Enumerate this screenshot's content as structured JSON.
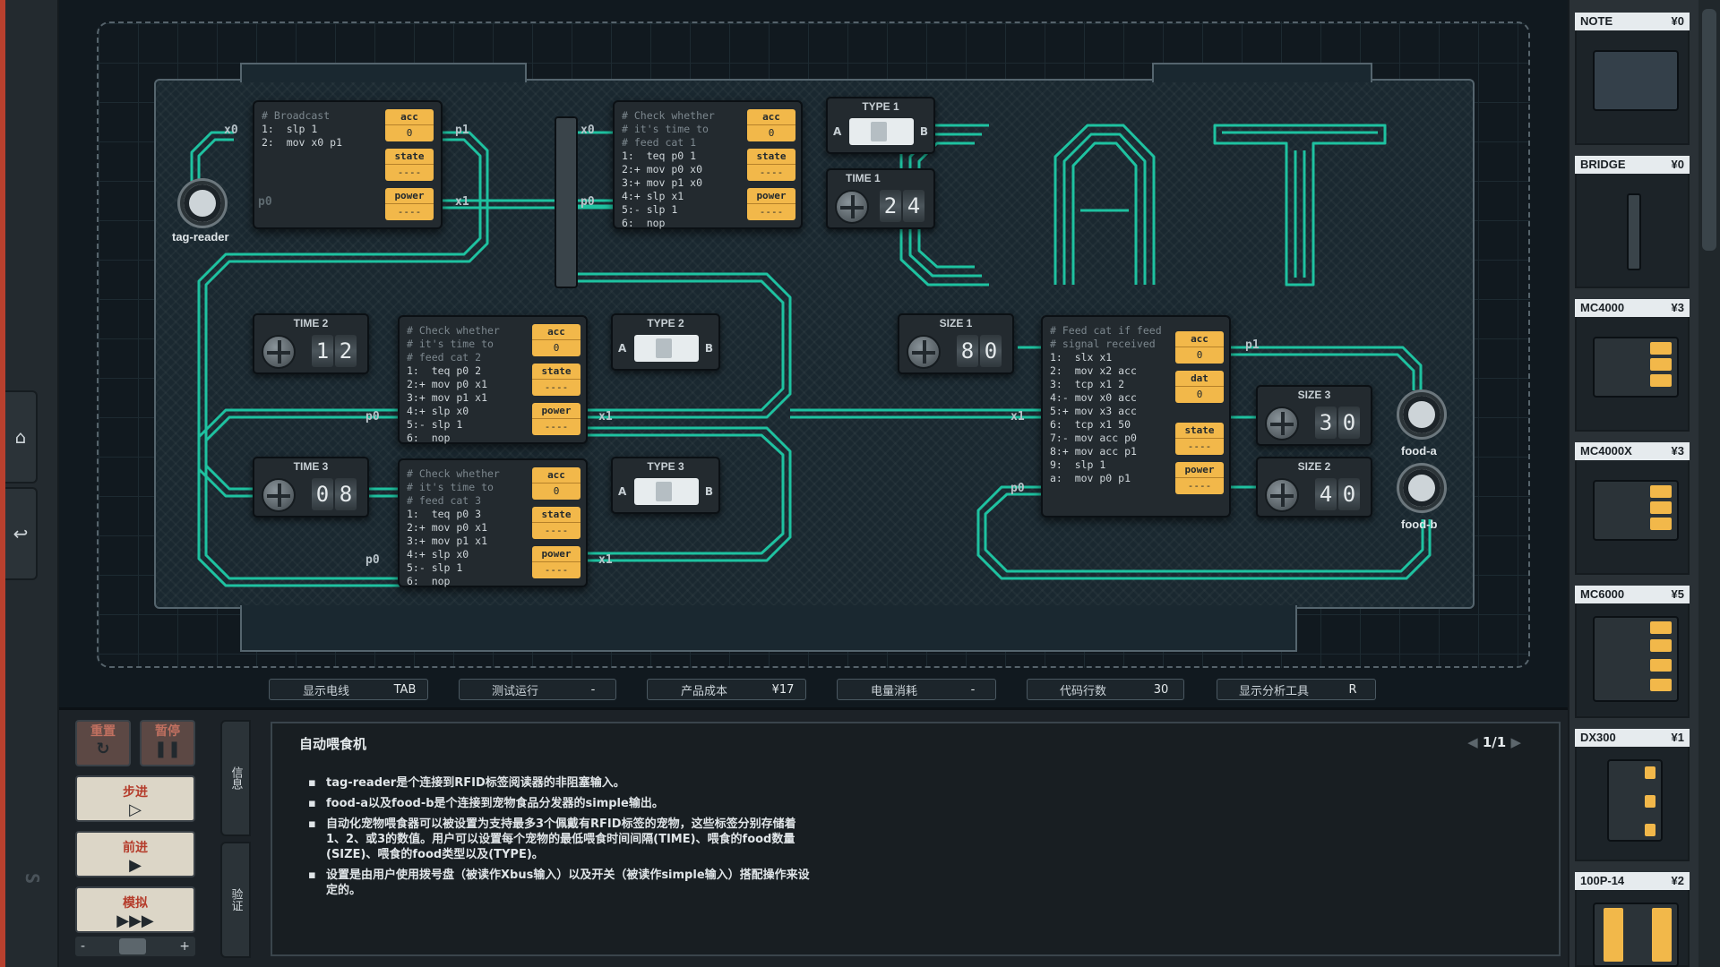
{
  "colors": {
    "wire": "#1fd3ad",
    "register": "#f2b84a",
    "accent_red": "#b8402e"
  },
  "sidebar": {
    "home_icon": "home-icon",
    "back_icon": "undo-icon"
  },
  "board": {
    "title_art": "CAT",
    "tag_reader": {
      "label": "tag-reader"
    },
    "food_a": {
      "label": "food-a"
    },
    "food_b": {
      "label": "food-b"
    },
    "mc_broadcast": {
      "comment": "# Broadcast",
      "lines": [
        "1:  slp 1",
        "2:  mov x0 p1"
      ],
      "ports": {
        "left_top": "x0",
        "right_top": "p1",
        "left_bottom": "p0",
        "right_bottom": "x1"
      },
      "registers": [
        {
          "label": "acc",
          "value": "0"
        },
        {
          "label": "state",
          "value": "----"
        },
        {
          "label": "power",
          "value": "----"
        }
      ]
    },
    "mc_cat1": {
      "comment": [
        "# Check whether",
        "# it's time to",
        "# feed cat 1"
      ],
      "lines": [
        "1:  teq p0 1",
        "2:+ mov p0 x0",
        "3:+ mov p1 x0",
        "4:+ slp x1",
        "5:- slp 1",
        "6:  nop"
      ],
      "ports": {
        "left_top": "x0",
        "left_bottom": "p0"
      },
      "registers": [
        {
          "label": "acc",
          "value": "0"
        },
        {
          "label": "state",
          "value": "----"
        },
        {
          "label": "power",
          "value": "----"
        }
      ]
    },
    "mc_cat2": {
      "comment": [
        "# Check whether",
        "# it's time to",
        "# feed cat 2"
      ],
      "lines": [
        "1:  teq p0 2",
        "2:+ mov p0 x1",
        "3:+ mov p1 x1",
        "4:+ slp x0",
        "5:- slp 1",
        "6:  nop"
      ],
      "ports": {
        "left_bottom": "p0",
        "right_bottom": "x1"
      },
      "registers": [
        {
          "label": "acc",
          "value": "0"
        },
        {
          "label": "state",
          "value": "----"
        },
        {
          "label": "power",
          "value": "----"
        }
      ]
    },
    "mc_cat3": {
      "comment": [
        "# Check whether",
        "# it's time to",
        "# feed cat 3"
      ],
      "lines": [
        "1:  teq p0 3",
        "2:+ mov p0 x1",
        "3:+ mov p1 x1",
        "4:+ slp x0",
        "5:- slp 1",
        "6:  nop"
      ],
      "ports": {
        "left_bottom": "p0",
        "right_bottom": "x1"
      },
      "registers": [
        {
          "label": "acc",
          "value": "0"
        },
        {
          "label": "state",
          "value": "----"
        },
        {
          "label": "power",
          "value": "----"
        }
      ]
    },
    "mc_feed": {
      "comment": [
        "# Feed cat if feed",
        "# signal received"
      ],
      "lines": [
        "1:  slx x1",
        "2:  mov x2 acc",
        "3:  tcp x1 2",
        "4:- mov x0 acc",
        "5:+ mov x3 acc",
        "6:  tcp x1 50",
        "7:- mov acc p0",
        "8:+ mov acc p1",
        "9:  slp 1",
        "a:  mov p0 p1"
      ],
      "ports": {
        "right_top": "p1",
        "left_mid": "x1",
        "left_bottom": "p0"
      },
      "registers": [
        {
          "label": "acc",
          "value": "0"
        },
        {
          "label": "dat",
          "value": "0"
        },
        {
          "label": "state",
          "value": "----"
        },
        {
          "label": "power",
          "value": "----"
        }
      ]
    },
    "type1": {
      "label": "TYPE 1",
      "a": "A",
      "b": "B"
    },
    "type2": {
      "label": "TYPE 2",
      "a": "A",
      "b": "B"
    },
    "type3": {
      "label": "TYPE 3",
      "a": "A",
      "b": "B"
    },
    "time1": {
      "label": "TIME 1",
      "digits": [
        "2",
        "4"
      ]
    },
    "time2": {
      "label": "TIME 2",
      "digits": [
        "1",
        "2"
      ]
    },
    "time3": {
      "label": "TIME 3",
      "digits": [
        "0",
        "8"
      ]
    },
    "size1": {
      "label": "SIZE 1",
      "digits": [
        "8",
        "0"
      ]
    },
    "size2": {
      "label": "SIZE 2",
      "digits": [
        "4",
        "0"
      ]
    },
    "size3": {
      "label": "SIZE 3",
      "digits": [
        "3",
        "0"
      ]
    }
  },
  "stats": [
    {
      "label": "显示电线",
      "value": "TAB"
    },
    {
      "label": "测试运行",
      "value": "-"
    },
    {
      "label": "产品成本",
      "value": "¥17"
    },
    {
      "label": "电量消耗",
      "value": "-"
    },
    {
      "label": "代码行数",
      "value": "30"
    },
    {
      "label": "显示分析工具",
      "value": "R"
    }
  ],
  "controls": {
    "reset": "重置",
    "pause": "暂停",
    "step": "步进",
    "advance": "前进",
    "simulate": "模拟",
    "reset_glyph": "↻",
    "pause_glyph": "❚❚",
    "step_glyph": "▷",
    "advance_glyph": "▶",
    "simulate_glyph": "▶▶▶",
    "minus": "-",
    "plus": "+"
  },
  "info_tabs": {
    "info": "信息",
    "verify": "验证"
  },
  "info": {
    "title": "自动喂食机",
    "page": "1/1",
    "bullets": [
      "tag-reader是个连接到RFID标签阅读器的非阻塞输入。",
      "food-a以及food-b是个连接到宠物食品分发器的simple输出。",
      "自动化宠物喂食器可以被设置为支持最多3个佩戴有RFID标签的宠物，这些标签分别存储着1、2、或3的数值。用户可以设置每个宠物的最低喂食时间间隔(TIME)、喂食的food数量(SIZE)、喂食的food类型以及(TYPE)。",
      "设置是由用户使用拨号盘（被读作Xbus输入）以及开关（被读作simple输入）搭配操作来设定的。"
    ]
  },
  "palette": [
    {
      "name": "NOTE",
      "price": "¥0"
    },
    {
      "name": "BRIDGE",
      "price": "¥0"
    },
    {
      "name": "MC4000",
      "price": "¥3"
    },
    {
      "name": "MC4000X",
      "price": "¥3"
    },
    {
      "name": "MC6000",
      "price": "¥5"
    },
    {
      "name": "DX300",
      "price": "¥1"
    },
    {
      "name": "100P-14",
      "price": "¥2"
    }
  ]
}
